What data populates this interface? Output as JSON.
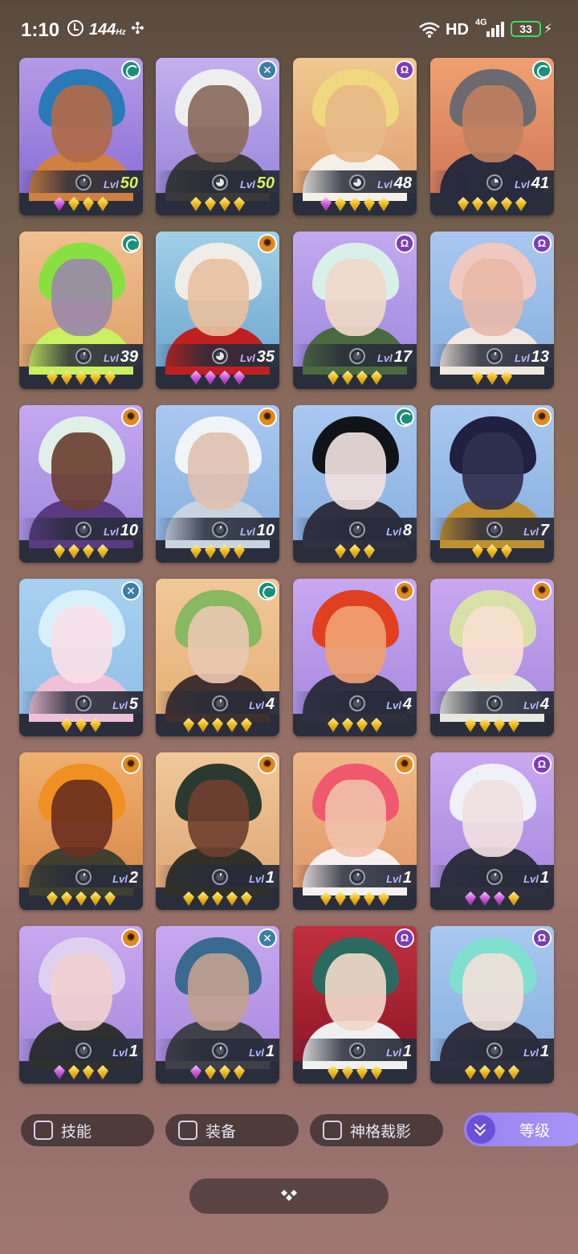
{
  "status_bar": {
    "time": "1:10",
    "refresh_rate": "144",
    "refresh_unit": "Hz",
    "network": "HD",
    "network_type": "4G",
    "battery": "33"
  },
  "lvl_prefix": "Lvl",
  "heroes": [
    {
      "level": "50",
      "class": "teal",
      "gems": [
        "p",
        "g",
        "g",
        "g"
      ],
      "skill": 0.1,
      "gold_level": true,
      "bg": [
        "#b69ae8",
        "#8a6fd6"
      ],
      "hair": "#2a7ab8",
      "skin": "#b06a48",
      "body": "#d08040"
    },
    {
      "level": "50",
      "class": "cross",
      "gems": [
        "g",
        "g",
        "g",
        "g"
      ],
      "skill": 0.75,
      "gold_level": true,
      "bg": [
        "#c4b0ee",
        "#9a86da"
      ],
      "hair": "#eeeeee",
      "skin": "#8a6a5a",
      "body": "#3a3a3a"
    },
    {
      "level": "48",
      "class": "purple",
      "gems": [
        "p",
        "g",
        "g",
        "g",
        "g"
      ],
      "skill": 0.75,
      "gold_level": false,
      "bg": [
        "#f0c890",
        "#e0a070"
      ],
      "hair": "#f0d880",
      "skin": "#e8b888",
      "body": "#f4f0e8"
    },
    {
      "level": "41",
      "class": "teal",
      "gems": [
        "g",
        "g",
        "g",
        "g",
        "g"
      ],
      "skill": 0.25,
      "gold_level": false,
      "bg": [
        "#f0a070",
        "#d07858"
      ],
      "hair": "#6a6a70",
      "skin": "#c08060",
      "body": "#2a2a40"
    },
    {
      "level": "39",
      "class": "teal",
      "gems": [
        "g",
        "g",
        "g",
        "g",
        "g"
      ],
      "skill": 0.1,
      "gold_level": false,
      "bg": [
        "#f0c090",
        "#e0a068"
      ],
      "hair": "#88e040",
      "skin": "#9a8aa8",
      "body": "#c8f060"
    },
    {
      "level": "35",
      "class": "orange",
      "gems": [
        "p",
        "p",
        "p",
        "p"
      ],
      "skill": 0.75,
      "gold_level": false,
      "bg": [
        "#a0d0e8",
        "#70a8d0"
      ],
      "hair": "#f0ece8",
      "skin": "#e8c0a0",
      "body": "#c02020"
    },
    {
      "level": "17",
      "class": "purple",
      "gems": [
        "g",
        "g",
        "g",
        "g"
      ],
      "skill": 0.1,
      "gold_level": false,
      "bg": [
        "#c4a8f0",
        "#a08ae0"
      ],
      "hair": "#d8f0e8",
      "skin": "#f0d8c8",
      "body": "#4a6a40"
    },
    {
      "level": "13",
      "class": "purple",
      "gems": [
        "g",
        "g",
        "g"
      ],
      "skill": 0.1,
      "gold_level": false,
      "bg": [
        "#a8c8f0",
        "#8ab0e0"
      ],
      "hair": "#f0c8c0",
      "skin": "#e8b8a8",
      "body": "#f0e8e0"
    },
    {
      "level": "10",
      "class": "orange",
      "gems": [
        "g",
        "g",
        "g",
        "g"
      ],
      "skill": 0.1,
      "gold_level": false,
      "bg": [
        "#c4a8f0",
        "#a08ae0"
      ],
      "hair": "#e0f0e8",
      "skin": "#6a4030",
      "body": "#5a3a80"
    },
    {
      "level": "10",
      "class": "orange",
      "gems": [
        "g",
        "g",
        "g",
        "g"
      ],
      "skill": 0.1,
      "gold_level": false,
      "bg": [
        "#a8c8f0",
        "#8ab0e0"
      ],
      "hair": "#f0f4f8",
      "skin": "#e0c0b0",
      "body": "#c8d4e0"
    },
    {
      "level": "8",
      "class": "teal",
      "gems": [
        "g",
        "g",
        "g"
      ],
      "skill": 0.1,
      "gold_level": false,
      "bg": [
        "#a8c8f0",
        "#8ab0e0"
      ],
      "hair": "#101418",
      "skin": "#f0e0e0",
      "body": "#303040"
    },
    {
      "level": "7",
      "class": "orange",
      "gems": [
        "g",
        "g",
        "g"
      ],
      "skill": 0.1,
      "gold_level": false,
      "bg": [
        "#a8c8f0",
        "#8ab0e0"
      ],
      "hair": "#202040",
      "skin": "#303050",
      "body": "#c09030"
    },
    {
      "level": "5",
      "class": "cross",
      "gems": [
        "g",
        "g",
        "g"
      ],
      "skill": 0.1,
      "gold_level": false,
      "bg": [
        "#a8d0f0",
        "#90c0e8"
      ],
      "hair": "#d8f0fa",
      "skin": "#f8e0e8",
      "body": "#f0c0d8"
    },
    {
      "level": "4",
      "class": "teal",
      "gems": [
        "g",
        "g",
        "g",
        "g",
        "g"
      ],
      "skill": 0.1,
      "gold_level": false,
      "bg": [
        "#f0c898",
        "#e8b078"
      ],
      "hair": "#88b860",
      "skin": "#e8c8b0",
      "body": "#403030"
    },
    {
      "level": "4",
      "class": "orange",
      "gems": [
        "g",
        "g",
        "g",
        "g"
      ],
      "skill": 0.1,
      "gold_level": false,
      "bg": [
        "#c8a8f0",
        "#a88ae0"
      ],
      "hair": "#e04020",
      "skin": "#f0a070",
      "body": "#303040"
    },
    {
      "level": "4",
      "class": "orange",
      "gems": [
        "g",
        "g",
        "g",
        "g"
      ],
      "skill": 0.1,
      "gold_level": false,
      "bg": [
        "#c8a8f0",
        "#a88ae0"
      ],
      "hair": "#d8e0a8",
      "skin": "#f8e0d0",
      "body": "#e8e8e0"
    },
    {
      "level": "2",
      "class": "orange",
      "gems": [
        "g",
        "g",
        "g",
        "g",
        "g"
      ],
      "skill": 0.1,
      "gold_level": false,
      "bg": [
        "#f0b070",
        "#d88848"
      ],
      "hair": "#f09020",
      "skin": "#6a3020",
      "body": "#404030"
    },
    {
      "level": "1",
      "class": "orange",
      "gems": [
        "g",
        "g",
        "g",
        "g",
        "g"
      ],
      "skill": 0.1,
      "gold_level": false,
      "bg": [
        "#f0c898",
        "#e0a878"
      ],
      "hair": "#2a3a30",
      "skin": "#704030",
      "body": "#303028"
    },
    {
      "level": "1",
      "class": "orange",
      "gems": [
        "g",
        "g",
        "g",
        "g",
        "g"
      ],
      "skill": 0.1,
      "gold_level": false,
      "bg": [
        "#f0b888",
        "#e09868"
      ],
      "hair": "#f05870",
      "skin": "#f0c0a8",
      "body": "#f8f0f0"
    },
    {
      "level": "1",
      "class": "purple",
      "gems": [
        "p",
        "p",
        "p",
        "g"
      ],
      "skill": 0.1,
      "gold_level": false,
      "bg": [
        "#c8a8f0",
        "#a88ae0"
      ],
      "hair": "#f0f0f8",
      "skin": "#f0e0e0",
      "body": "#303040"
    },
    {
      "level": "1",
      "class": "orange",
      "gems": [
        "p",
        "g",
        "g",
        "g"
      ],
      "skill": 0.1,
      "gold_level": false,
      "bg": [
        "#c8a8f0",
        "#a88ae0"
      ],
      "hair": "#e0d0f0",
      "skin": "#f0d0d0",
      "body": "#303030"
    },
    {
      "level": "1",
      "class": "cross",
      "gems": [
        "p",
        "g",
        "g",
        "g"
      ],
      "skill": 0.1,
      "gold_level": false,
      "bg": [
        "#c8a8f0",
        "#a88ae0"
      ],
      "hair": "#3a6a90",
      "skin": "#c0a090",
      "body": "#404048"
    },
    {
      "level": "1",
      "class": "purple",
      "gems": [
        "g",
        "g",
        "g",
        "g"
      ],
      "skill": 0.1,
      "gold_level": false,
      "bg": [
        "#c03040",
        "#901828"
      ],
      "hair": "#2a6a60",
      "skin": "#f0d8c8",
      "body": "#f0f0f0"
    },
    {
      "level": "1",
      "class": "purple",
      "gems": [
        "g",
        "g",
        "g",
        "g"
      ],
      "skill": 0.1,
      "gold_level": false,
      "bg": [
        "#a8c8f0",
        "#8ab0e0"
      ],
      "hair": "#80e0d0",
      "skin": "#f0e0d8",
      "body": "#303040"
    }
  ],
  "filters": {
    "skill_label": "技能",
    "equipment_label": "装备",
    "divine_label": "神格裁影",
    "sort_label": "等级"
  }
}
